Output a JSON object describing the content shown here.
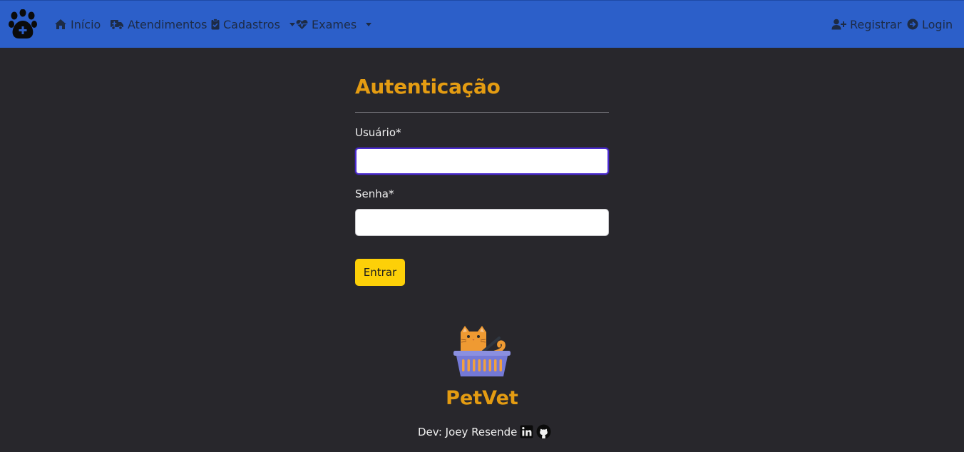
{
  "navbar": {
    "items": [
      {
        "label": "Início",
        "icon": "home-icon"
      },
      {
        "label": "Atendimentos",
        "icon": "ambulance-icon"
      },
      {
        "label": "Cadastros",
        "icon": "clipboard-check-icon"
      },
      {
        "label": "Exames",
        "icon": "heart-pulse-icon"
      }
    ],
    "right": [
      {
        "label": "Registrar",
        "icon": "user-plus-icon"
      },
      {
        "label": "Login",
        "icon": "arrow-circle-right-icon"
      }
    ]
  },
  "form": {
    "title": "Autenticação",
    "user_label": "Usuário*",
    "user_value": "",
    "password_label": "Senha*",
    "password_value": "",
    "submit_label": "Entrar"
  },
  "footer": {
    "brand": "PetVet",
    "dev_text": "Dev: Joey Resende"
  },
  "colors": {
    "navbar": "#2c5fc9",
    "background": "#28272c",
    "accent": "#e49c12",
    "button": "#fdd008"
  }
}
